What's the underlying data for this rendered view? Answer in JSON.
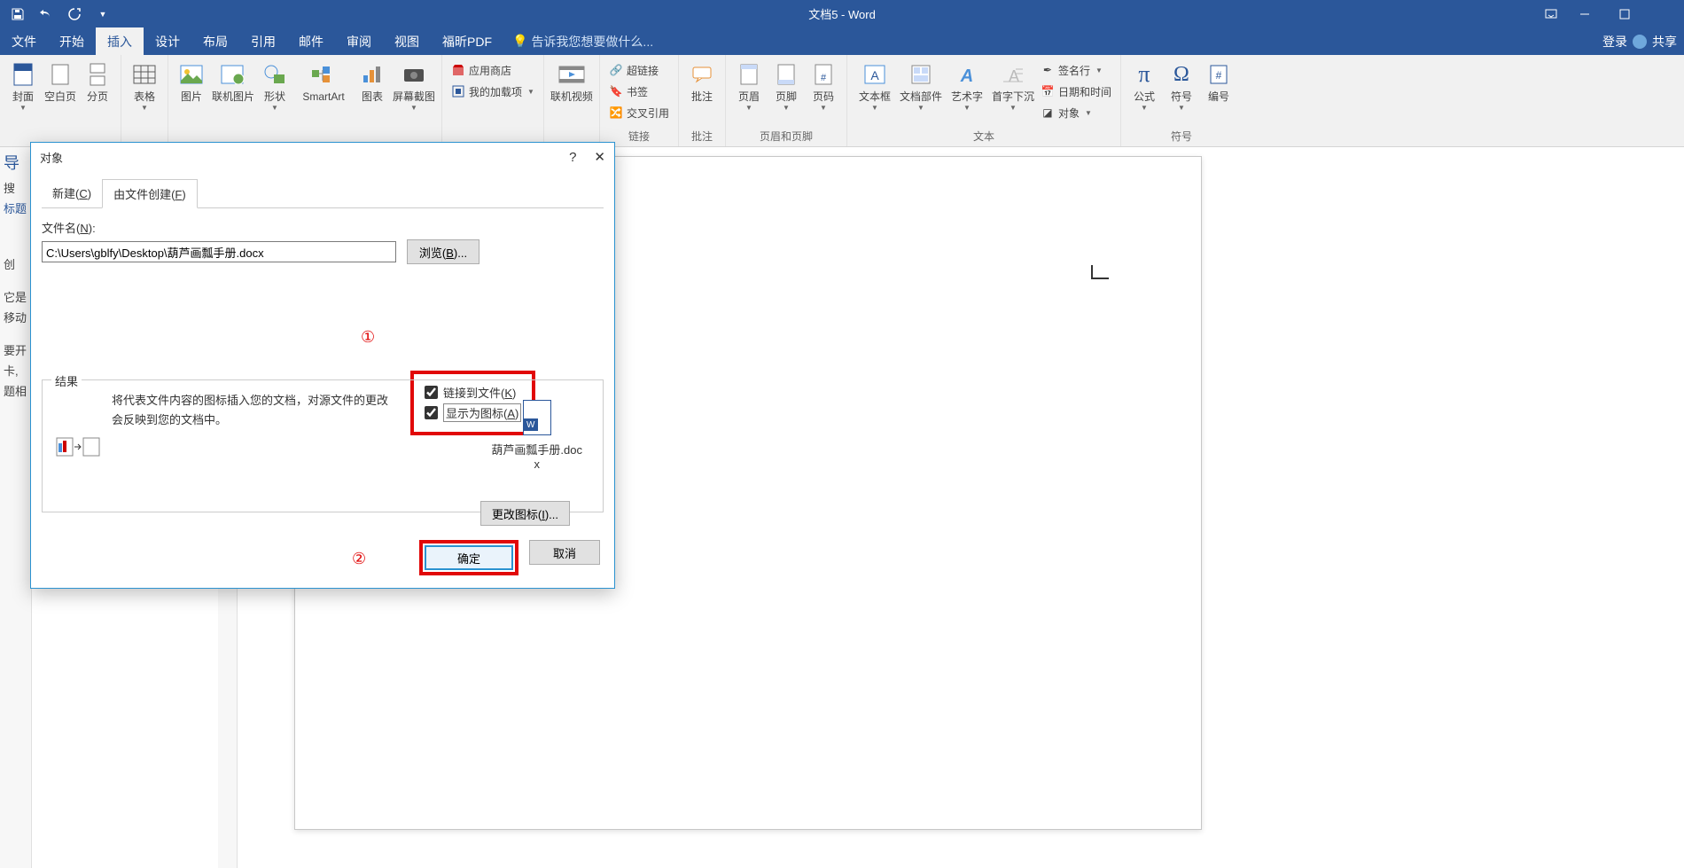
{
  "titlebar": {
    "title": "文档5 - Word"
  },
  "tabs": {
    "file": "文件",
    "home": "开始",
    "insert": "插入",
    "design": "设计",
    "layout": "布局",
    "references": "引用",
    "mailings": "邮件",
    "review": "审阅",
    "view": "视图",
    "foxit": "福昕PDF",
    "tellme": "告诉我您想要做什么...",
    "signin": "登录",
    "share": "共享"
  },
  "ribbon": {
    "cover": "封面",
    "blank": "空白页",
    "page_break": "分页",
    "table": "表格",
    "picture": "图片",
    "online_pic": "联机图片",
    "shapes": "形状",
    "smartart": "SmartArt",
    "chart": "图表",
    "screenshot": "屏幕截图",
    "store": "应用商店",
    "addins": "我的加载项",
    "onlinevideo": "联机视频",
    "hyperlink": "超链接",
    "bookmark": "书签",
    "crossref": "交叉引用",
    "comment": "批注",
    "header": "页眉",
    "footer": "页脚",
    "pagenum": "页码",
    "textbox": "文本框",
    "quickparts": "文档部件",
    "wordart": "艺术字",
    "dropcap": "首字下沉",
    "sigline": "签名行",
    "datetime": "日期和时间",
    "object": "对象",
    "equation": "公式",
    "symbol": "符号",
    "number": "编号",
    "grp_links": "链接",
    "grp_comments": "批注",
    "grp_hf": "页眉和页脚",
    "grp_text": "文本",
    "grp_symbols": "符号"
  },
  "nav": {
    "title": "导",
    "search": "搜",
    "heading": "标题",
    "create": "创",
    "it": "它是",
    "move": "移动",
    "req": "要开",
    "card": "卡,",
    "topic": "题相"
  },
  "dialog": {
    "title": "对象",
    "help": "?",
    "tab_new": "新建(C)",
    "tab_fromfile": "由文件创建(F)",
    "filename_label": "文件名(N):",
    "filename_value": "C:\\Users\\gblfy\\Desktop\\葫芦画瓢手册.docx",
    "browse": "浏览(B)...",
    "linktofile": "链接到文件(K)",
    "displayasicon": "显示为图标(A)",
    "result_label": "结果",
    "result_text": "将代表文件内容的图标插入您的文档，对源文件的更改会反映到您的文档中。",
    "preview_name": "葫芦画瓢手册.docx",
    "change_icon": "更改图标(I)...",
    "ok": "确定",
    "cancel": "取消",
    "ann1": "①",
    "ann2": "②"
  }
}
